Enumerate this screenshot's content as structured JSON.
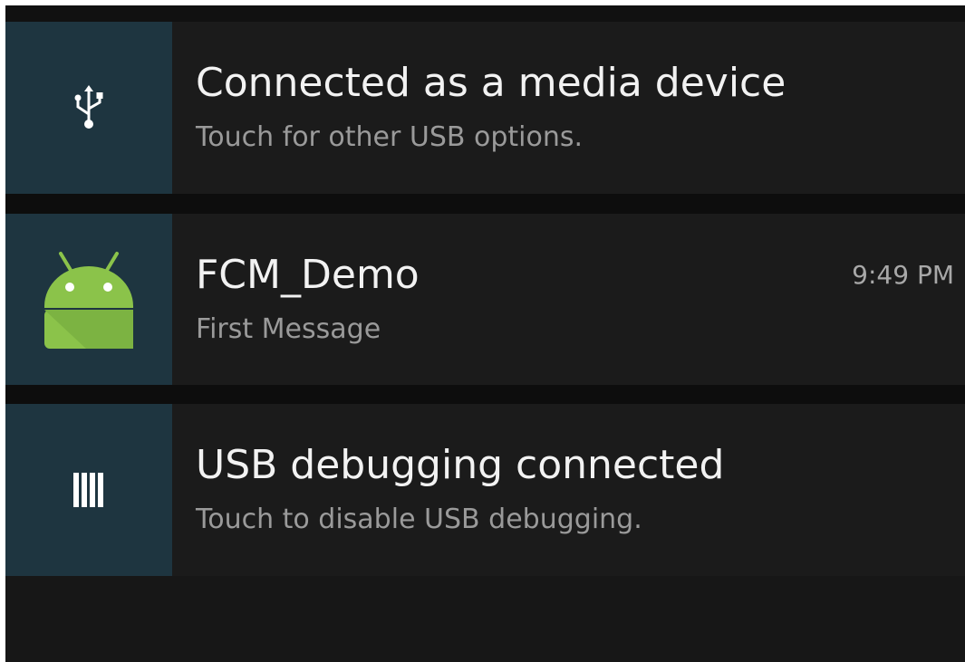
{
  "notifications": [
    {
      "title": "Connected as a media device",
      "subtitle": "Touch for other USB options.",
      "icon": "usb-icon",
      "icon_bg": "#1e3540"
    },
    {
      "title": "FCM_Demo",
      "subtitle": "First Message",
      "time": "9:49 PM",
      "icon": "android-icon",
      "icon_color": "#8bc34a"
    },
    {
      "title": "USB debugging connected",
      "subtitle": "Touch to disable USB debugging.",
      "icon": "debug-icon"
    }
  ],
  "colors": {
    "background": "#0f0f0f",
    "card": "#1b1b1b",
    "title_text": "#f2f2f2",
    "subtitle_text": "#9a9a9a"
  }
}
